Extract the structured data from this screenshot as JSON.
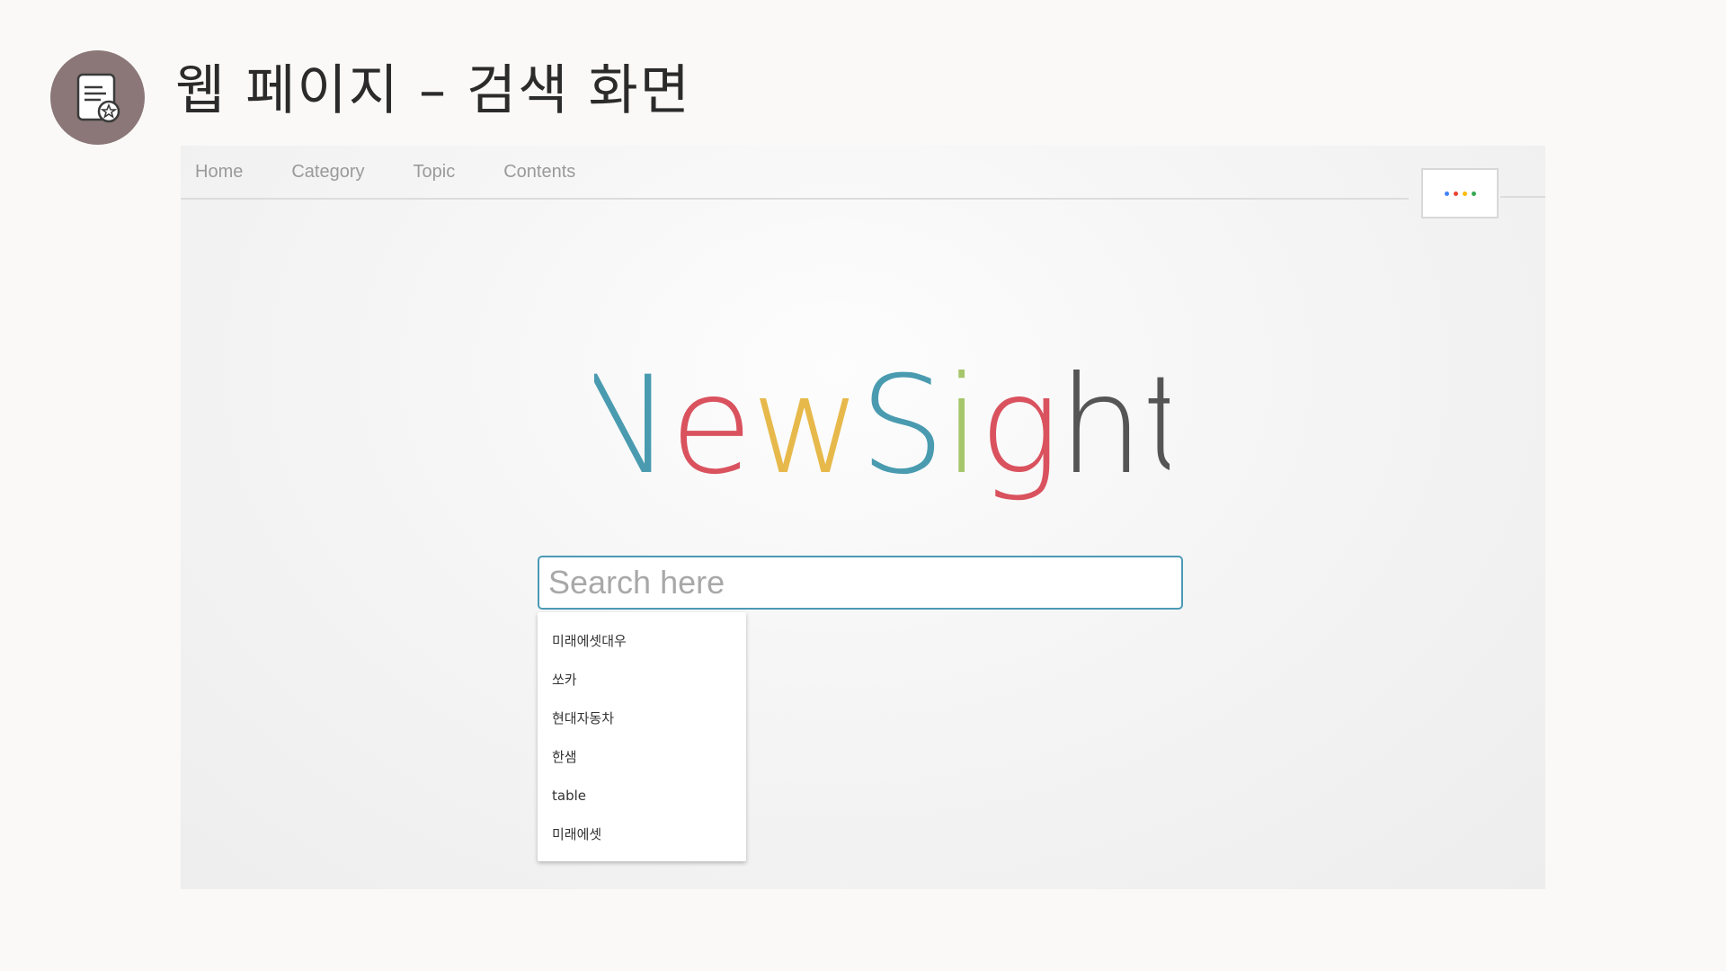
{
  "slide": {
    "title": "웹 페이지 – 검색 화면",
    "badge_icon": "document-star-icon"
  },
  "nav": {
    "items": [
      "Home",
      "Category",
      "Topic",
      "Contents"
    ]
  },
  "apps_button": {
    "icon": "apps-dots-icon",
    "dot_colors": [
      "#4285f4",
      "#ea4335",
      "#fbbc05",
      "#34a853"
    ]
  },
  "logo": {
    "letters": [
      {
        "char": "N",
        "color": "#4a9bb0"
      },
      {
        "char": "e",
        "color": "#d9525e"
      },
      {
        "char": "w",
        "color": "#e7b94b"
      },
      {
        "char": "S",
        "color": "#4a9bb0"
      },
      {
        "char": "i",
        "color": "#a6c66c"
      },
      {
        "char": "g",
        "color": "#d9525e"
      },
      {
        "char": "h",
        "color": "#555555"
      },
      {
        "char": "t",
        "color": "#555555"
      }
    ]
  },
  "search": {
    "placeholder": "Search here",
    "value": ""
  },
  "suggestions": [
    "미래에셋대우",
    "쏘카",
    "현대자동차",
    "한샘",
    "table",
    "미래에셋"
  ],
  "colors": {
    "accent": "#4b9ab5",
    "badge": "#8b7777"
  }
}
